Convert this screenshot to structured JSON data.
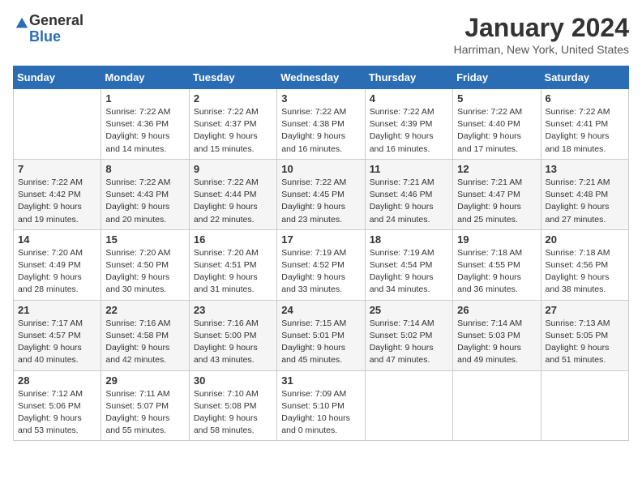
{
  "logo": {
    "general": "General",
    "blue": "Blue"
  },
  "title": "January 2024",
  "location": "Harriman, New York, United States",
  "weekdays": [
    "Sunday",
    "Monday",
    "Tuesday",
    "Wednesday",
    "Thursday",
    "Friday",
    "Saturday"
  ],
  "weeks": [
    [
      {
        "day": "",
        "info": ""
      },
      {
        "day": "1",
        "info": "Sunrise: 7:22 AM\nSunset: 4:36 PM\nDaylight: 9 hours\nand 14 minutes."
      },
      {
        "day": "2",
        "info": "Sunrise: 7:22 AM\nSunset: 4:37 PM\nDaylight: 9 hours\nand 15 minutes."
      },
      {
        "day": "3",
        "info": "Sunrise: 7:22 AM\nSunset: 4:38 PM\nDaylight: 9 hours\nand 16 minutes."
      },
      {
        "day": "4",
        "info": "Sunrise: 7:22 AM\nSunset: 4:39 PM\nDaylight: 9 hours\nand 16 minutes."
      },
      {
        "day": "5",
        "info": "Sunrise: 7:22 AM\nSunset: 4:40 PM\nDaylight: 9 hours\nand 17 minutes."
      },
      {
        "day": "6",
        "info": "Sunrise: 7:22 AM\nSunset: 4:41 PM\nDaylight: 9 hours\nand 18 minutes."
      }
    ],
    [
      {
        "day": "7",
        "info": ""
      },
      {
        "day": "8",
        "info": "Sunrise: 7:22 AM\nSunset: 4:43 PM\nDaylight: 9 hours\nand 20 minutes."
      },
      {
        "day": "9",
        "info": "Sunrise: 7:22 AM\nSunset: 4:44 PM\nDaylight: 9 hours\nand 22 minutes."
      },
      {
        "day": "10",
        "info": "Sunrise: 7:22 AM\nSunset: 4:45 PM\nDaylight: 9 hours\nand 23 minutes."
      },
      {
        "day": "11",
        "info": "Sunrise: 7:21 AM\nSunset: 4:46 PM\nDaylight: 9 hours\nand 24 minutes."
      },
      {
        "day": "12",
        "info": "Sunrise: 7:21 AM\nSunset: 4:47 PM\nDaylight: 9 hours\nand 25 minutes."
      },
      {
        "day": "13",
        "info": "Sunrise: 7:21 AM\nSunset: 4:48 PM\nDaylight: 9 hours\nand 27 minutes."
      }
    ],
    [
      {
        "day": "14",
        "info": ""
      },
      {
        "day": "15",
        "info": "Sunrise: 7:20 AM\nSunset: 4:50 PM\nDaylight: 9 hours\nand 30 minutes."
      },
      {
        "day": "16",
        "info": "Sunrise: 7:20 AM\nSunset: 4:51 PM\nDaylight: 9 hours\nand 31 minutes."
      },
      {
        "day": "17",
        "info": "Sunrise: 7:19 AM\nSunset: 4:52 PM\nDaylight: 9 hours\nand 33 minutes."
      },
      {
        "day": "18",
        "info": "Sunrise: 7:19 AM\nSunset: 4:54 PM\nDaylight: 9 hours\nand 34 minutes."
      },
      {
        "day": "19",
        "info": "Sunrise: 7:18 AM\nSunset: 4:55 PM\nDaylight: 9 hours\nand 36 minutes."
      },
      {
        "day": "20",
        "info": "Sunrise: 7:18 AM\nSunset: 4:56 PM\nDaylight: 9 hours\nand 38 minutes."
      }
    ],
    [
      {
        "day": "21",
        "info": ""
      },
      {
        "day": "22",
        "info": "Sunrise: 7:16 AM\nSunset: 4:58 PM\nDaylight: 9 hours\nand 42 minutes."
      },
      {
        "day": "23",
        "info": "Sunrise: 7:16 AM\nSunset: 5:00 PM\nDaylight: 9 hours\nand 43 minutes."
      },
      {
        "day": "24",
        "info": "Sunrise: 7:15 AM\nSunset: 5:01 PM\nDaylight: 9 hours\nand 45 minutes."
      },
      {
        "day": "25",
        "info": "Sunrise: 7:14 AM\nSunset: 5:02 PM\nDaylight: 9 hours\nand 47 minutes."
      },
      {
        "day": "26",
        "info": "Sunrise: 7:14 AM\nSunset: 5:03 PM\nDaylight: 9 hours\nand 49 minutes."
      },
      {
        "day": "27",
        "info": "Sunrise: 7:13 AM\nSunset: 5:05 PM\nDaylight: 9 hours\nand 51 minutes."
      }
    ],
    [
      {
        "day": "28",
        "info": ""
      },
      {
        "day": "29",
        "info": "Sunrise: 7:11 AM\nSunset: 5:07 PM\nDaylight: 9 hours\nand 55 minutes."
      },
      {
        "day": "30",
        "info": "Sunrise: 7:10 AM\nSunset: 5:08 PM\nDaylight: 9 hours\nand 58 minutes."
      },
      {
        "day": "31",
        "info": "Sunrise: 7:09 AM\nSunset: 5:10 PM\nDaylight: 10 hours\nand 0 minutes."
      },
      {
        "day": "",
        "info": ""
      },
      {
        "day": "",
        "info": ""
      },
      {
        "day": "",
        "info": ""
      }
    ]
  ],
  "week1_sun_info": "Sunrise: 7:22 AM\nSunset: 4:42 PM\nDaylight: 9 hours\nand 19 minutes.",
  "week3_sun_info": "Sunrise: 7:20 AM\nSunset: 4:49 PM\nDaylight: 9 hours\nand 28 minutes.",
  "week4_sun_info": "Sunrise: 7:17 AM\nSunset: 4:57 PM\nDaylight: 9 hours\nand 40 minutes.",
  "week5_sun_info": "Sunrise: 7:12 AM\nSunset: 5:06 PM\nDaylight: 9 hours\nand 53 minutes."
}
